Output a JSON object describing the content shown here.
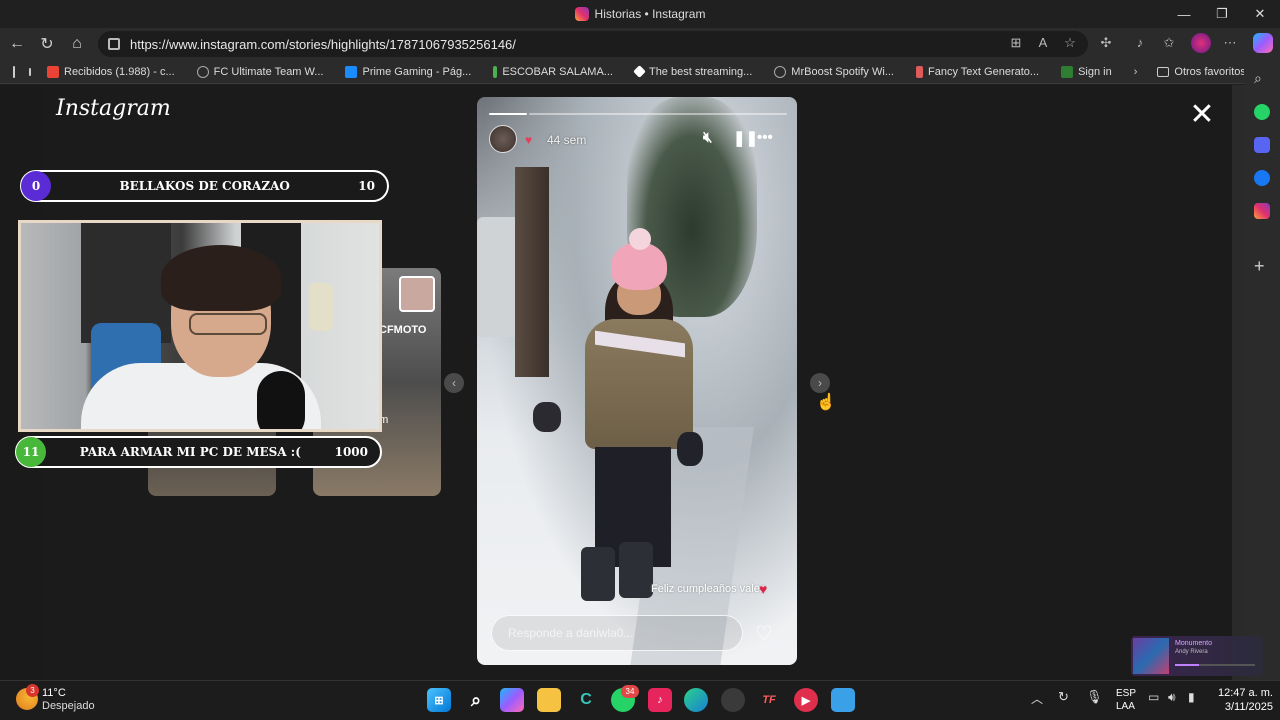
{
  "window": {
    "title": "Historias • Instagram",
    "controls": [
      "—",
      "❐",
      "✕"
    ]
  },
  "nav": {
    "url": "https://www.instagram.com/stories/highlights/17871067935256146/"
  },
  "bookmarks": {
    "items": [
      {
        "label": "Recibidos (1.988) - c...",
        "color": "#ea4335"
      },
      {
        "label": "FC Ultimate Team W...",
        "color": "#9aa0a6"
      },
      {
        "label": "Prime Gaming - Pág...",
        "color": "#1a8cff"
      },
      {
        "label": "ESCOBAR SALAMA...",
        "color": "#4caf50"
      },
      {
        "label": "The best streaming...",
        "color": "#ffffff"
      },
      {
        "label": "MrBoost Spotify Wi...",
        "color": "#9aa0a6"
      },
      {
        "label": "Fancy Text Generato...",
        "color": "#e05a5a"
      },
      {
        "label": "Sign in",
        "color": "#2e7d32"
      }
    ],
    "others": "Otros favoritos"
  },
  "instagram": {
    "logo": "Instagram",
    "tile2_text": "CFMOTO",
    "tile2_sub": "em"
  },
  "story": {
    "time": "44 sem",
    "caption": "Feliz cumpleaños valen",
    "reply_placeholder": "Responde a daniwla0...",
    "progress_fraction": 0.13
  },
  "overlay": {
    "goal1": {
      "start": "0",
      "label": "BELLAKOS DE CORAZAO",
      "target": "10"
    },
    "goal2": {
      "start": "11",
      "label": "PARA ARMAR MI PC DE MESA :(",
      "target": "1000"
    }
  },
  "media": {
    "title": "Monumento",
    "artist": "Andy Rivera"
  },
  "taskbar": {
    "weather_temp": "11°C",
    "weather_desc": "Despejado",
    "weather_badge": "3",
    "whatsapp_badge": "34",
    "lang_line1": "ESP",
    "lang_line2": "LAA",
    "time": "12:47 a. m.",
    "date": "3/11/2025"
  }
}
